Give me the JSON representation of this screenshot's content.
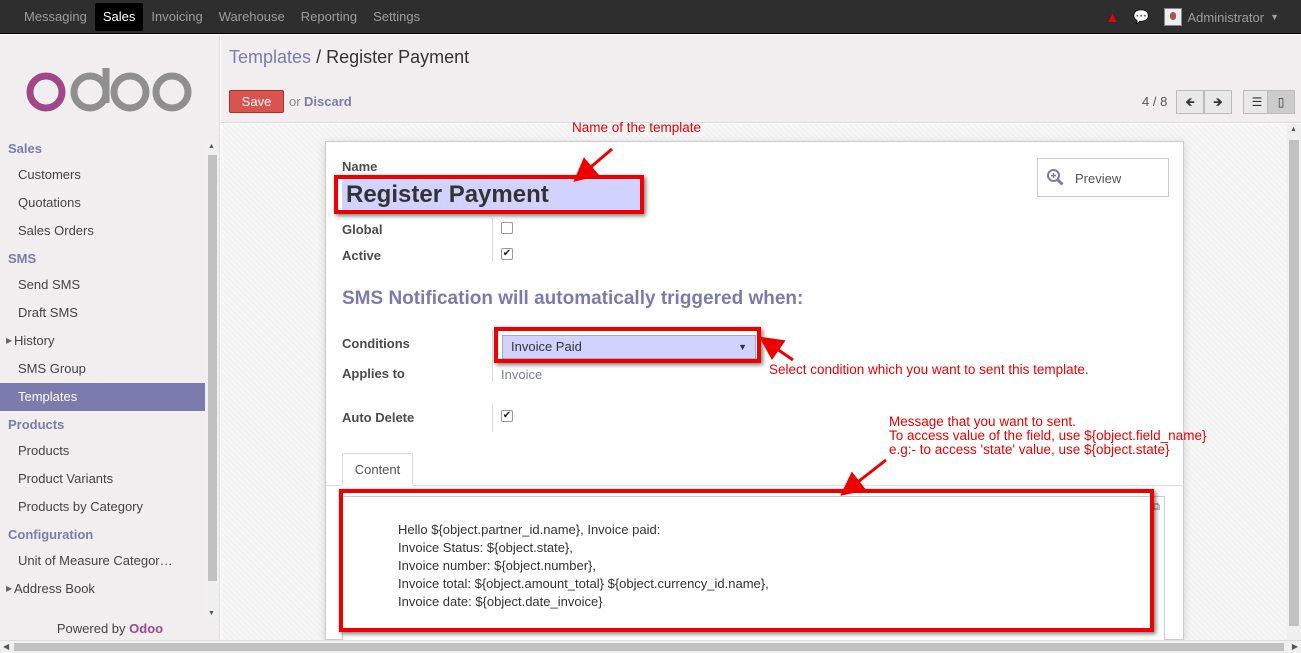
{
  "topbar": {
    "menu": [
      "Messaging",
      "Sales",
      "Invoicing",
      "Warehouse",
      "Reporting",
      "Settings"
    ],
    "active": "Sales",
    "user": "Administrator"
  },
  "sidebar": {
    "logo": "odoo",
    "sections": [
      {
        "title": "Sales",
        "items": [
          "Customers",
          "Quotations",
          "Sales Orders"
        ]
      },
      {
        "title": "SMS",
        "items": [
          "Send SMS",
          "Draft SMS",
          "History",
          "SMS Group",
          "Templates"
        ]
      },
      {
        "title": "Products",
        "items": [
          "Products",
          "Product Variants",
          "Products by Category"
        ]
      },
      {
        "title": "Configuration",
        "items": [
          "Unit of Measure Categor…",
          "Address Book"
        ]
      }
    ],
    "active_item": "Templates",
    "powered_prefix": "Powered by",
    "powered_brand": "Odoo"
  },
  "header": {
    "breadcrumb_parent": "Templates",
    "breadcrumb_sep": "/",
    "breadcrumb_current": "Register Payment",
    "save_label": "Save",
    "or_label": "or",
    "discard_label": "Discard",
    "pager": "4 / 8"
  },
  "form": {
    "name_label": "Name",
    "name_value": "Register Payment",
    "preview_label": "Preview",
    "global_label": "Global",
    "global_checked": false,
    "active_label": "Active",
    "active_checked": true,
    "section_title": "SMS Notification will automatically triggered when:",
    "conditions_label": "Conditions",
    "conditions_value": "Invoice Paid",
    "applies_label": "Applies to",
    "applies_value": "Invoice",
    "auto_delete_label": "Auto Delete",
    "auto_delete_checked": true,
    "tab_label": "Content",
    "body_lines": [
      "Hello ${object.partner_id.name}, Invoice paid:",
      "Invoice Status: ${object.state},",
      "Invoice number: ${object.number},",
      "Invoice total: ${object.amount_total} ${object.currency_id.name},",
      "Invoice date: ${object.date_invoice}"
    ]
  },
  "annotations": {
    "name_note": "Name of the template",
    "condition_note": "Select condition which you want to sent this template.",
    "message_note_1": "Message that you want to sent.",
    "message_note_2": "To access value of the field, use ${object.field_name}",
    "message_note_3": "e.g:- to access 'state' value, use ${object.state}",
    "color": "#ee0000"
  },
  "colors": {
    "accent": "#7c7bad",
    "save": "#d9534f",
    "topbar": "#2e2e2e",
    "brand": "#a24689"
  }
}
